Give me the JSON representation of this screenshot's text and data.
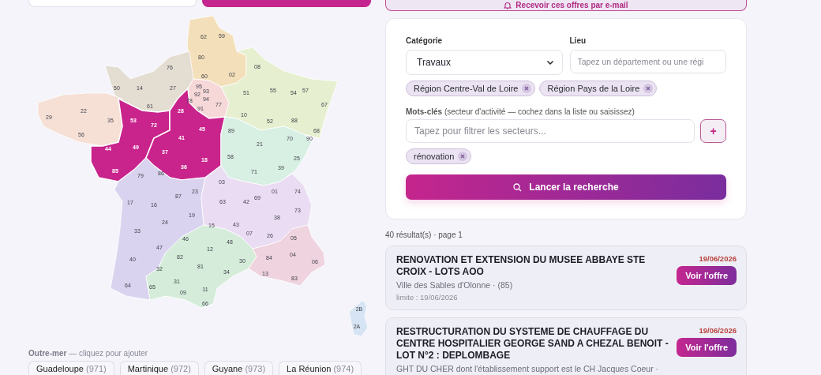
{
  "top_buttons": [
    {
      "kind": "plain"
    },
    {
      "kind": "primary"
    }
  ],
  "email_button": {
    "label": "Recevoir ces offres par e-mail"
  },
  "map": {
    "regions": [
      {
        "color": "#f3dfb9",
        "selected": false,
        "departments": [
          "62",
          "59",
          "80",
          "60",
          "02"
        ]
      },
      {
        "color": "#e3ddd2",
        "selected": false,
        "departments": [
          "76",
          "50",
          "14",
          "27",
          "61"
        ]
      },
      {
        "color": "#f6d8d8",
        "selected": false,
        "departments": [
          "95",
          "78",
          "92",
          "93",
          "94",
          "91",
          "77"
        ]
      },
      {
        "color": "#e6efcf",
        "selected": false,
        "departments": [
          "08",
          "51",
          "55",
          "54",
          "57",
          "67",
          "10",
          "52",
          "88",
          "68"
        ]
      },
      {
        "color": "#f6e0d6",
        "selected": false,
        "departments": [
          "29",
          "22",
          "35",
          "56"
        ]
      },
      {
        "color": "#c9238c",
        "selected": true,
        "departments": [
          "53",
          "72",
          "44",
          "49",
          "85"
        ]
      },
      {
        "color": "#c9238c",
        "selected": true,
        "departments": [
          "28",
          "45",
          "41",
          "37",
          "36",
          "18"
        ]
      },
      {
        "color": "#d8efe3",
        "selected": false,
        "departments": [
          "89",
          "21",
          "70",
          "90",
          "58",
          "71",
          "25",
          "39"
        ]
      },
      {
        "color": "#d9d3ef",
        "selected": false,
        "departments": [
          "79",
          "86",
          "87",
          "23",
          "17",
          "16",
          "19",
          "24",
          "33",
          "47",
          "40",
          "64"
        ]
      },
      {
        "color": "#eadcf2",
        "selected": false,
        "departments": [
          "03",
          "63",
          "42",
          "69",
          "01",
          "74",
          "73",
          "38",
          "15",
          "43",
          "07",
          "26"
        ]
      },
      {
        "color": "#d4ecd9",
        "selected": false,
        "departments": [
          "46",
          "12",
          "48",
          "82",
          "81",
          "30",
          "32",
          "34",
          "31",
          "65",
          "09",
          "11",
          "66"
        ]
      },
      {
        "color": "#efd3de",
        "selected": false,
        "departments": [
          "05",
          "04",
          "06",
          "84",
          "13",
          "83"
        ]
      },
      {
        "color": "#d6e4f3",
        "selected": false,
        "departments": [
          "2B",
          "2A"
        ]
      }
    ]
  },
  "overseas": {
    "heading": "**Outre-mer** — cliquez pour ajouter",
    "items": [
      {
        "name": "Guadeloupe",
        "code": "(971)"
      },
      {
        "name": "Martinique",
        "code": "(972)"
      },
      {
        "name": "Guyane",
        "code": "(973)"
      },
      {
        "name": "La Réunion",
        "code": "(974)"
      }
    ]
  },
  "search_form": {
    "category": {
      "label": "Catégorie",
      "value": "Travaux"
    },
    "location": {
      "label": "Lieu",
      "placeholder": "Tapez un département ou une régi"
    },
    "location_tags": [
      "Région Centre-Val de Loire",
      "Région Pays de la Loire"
    ],
    "keywords": {
      "label": "**Mots-clés** (secteur d'activité — cochez dans la liste ou saisissez)",
      "placeholder": "Tapez pour filtrer les secteurs...",
      "add": "+"
    },
    "keyword_tags": [
      "rénovation"
    ],
    "submit": "Lancer la recherche"
  },
  "results": {
    "count": "40 résultat(s) · page 1",
    "items": [
      {
        "title": "RENOVATION ET EXTENSION DU MUSEE ABBAYE STE CROIX - LOTS AOO",
        "buyer": "Ville des Sables d'Olonne · (85)",
        "deadline": "limite : 19/06/2026",
        "date": "19/06/2026",
        "action": "Voir l'offre"
      },
      {
        "title": "RESTRUCTURATION DU SYSTEME DE CHAUFFAGE DU CENTRE HOSPITALIER GEORGE SAND A CHEZAL BENOIT - LOT N°2 : DEPLOMBAGE",
        "buyer": "GHT DU CHER dont l'établissement support est le CH Jacques Coeur ·",
        "date": "19/06/2026",
        "action": "Voir l'offre"
      }
    ]
  }
}
